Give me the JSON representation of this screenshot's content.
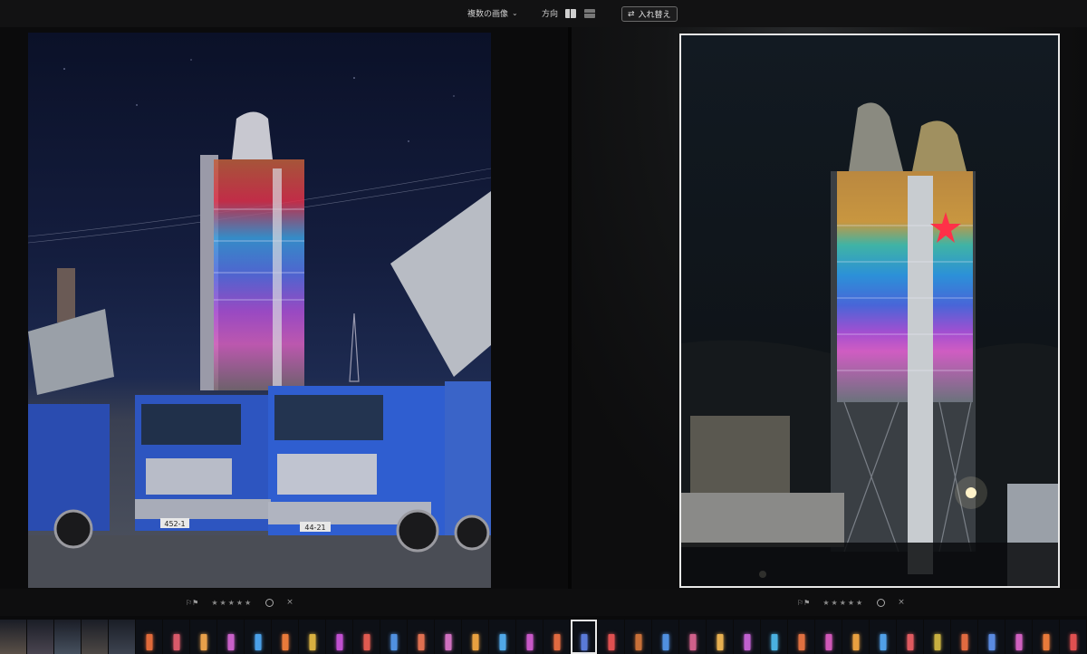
{
  "toolbar": {
    "view_mode_label": "複数の画像",
    "direction_label": "方向",
    "swap_label": "入れ替え"
  },
  "left_image": {
    "truck_plates": [
      "452-1",
      "44-21"
    ]
  },
  "rating_bar": {
    "stars": "★★★★★",
    "reject": "×"
  },
  "filmstrip": {
    "selected_index": 21,
    "thumbs": [
      {
        "kind": "industrial",
        "color": "#5a5048"
      },
      {
        "kind": "industrial",
        "color": "#4a4550"
      },
      {
        "kind": "industrial",
        "color": "#46505e"
      },
      {
        "kind": "industrial",
        "color": "#4d4845"
      },
      {
        "kind": "industrial",
        "color": "#3d4350"
      },
      {
        "kind": "tower",
        "color": "#e06a3a"
      },
      {
        "kind": "tower",
        "color": "#d95a6a"
      },
      {
        "kind": "tower",
        "color": "#e8a04a"
      },
      {
        "kind": "tower",
        "color": "#c860c8"
      },
      {
        "kind": "tower",
        "color": "#4aa0e8"
      },
      {
        "kind": "tower",
        "color": "#e87a3a"
      },
      {
        "kind": "tower",
        "color": "#d8b040"
      },
      {
        "kind": "tower",
        "color": "#c050d0"
      },
      {
        "kind": "tower",
        "color": "#e05a50"
      },
      {
        "kind": "tower",
        "color": "#5090e0"
      },
      {
        "kind": "tower",
        "color": "#e07050"
      },
      {
        "kind": "tower",
        "color": "#d070c0"
      },
      {
        "kind": "tower",
        "color": "#e8a040"
      },
      {
        "kind": "tower",
        "color": "#50a8e8"
      },
      {
        "kind": "tower",
        "color": "#c858c8"
      },
      {
        "kind": "tower",
        "color": "#e06a40"
      },
      {
        "kind": "tower",
        "color": "#5a7ad8"
      },
      {
        "kind": "tower",
        "color": "#e05050"
      },
      {
        "kind": "tower",
        "color": "#c87038"
      },
      {
        "kind": "tower",
        "color": "#5090e0"
      },
      {
        "kind": "tower",
        "color": "#d0608a"
      },
      {
        "kind": "tower",
        "color": "#e8b050"
      },
      {
        "kind": "tower",
        "color": "#c060d0"
      },
      {
        "kind": "tower",
        "color": "#4ab0e0"
      },
      {
        "kind": "tower",
        "color": "#e07040"
      },
      {
        "kind": "tower",
        "color": "#d058b8"
      },
      {
        "kind": "tower",
        "color": "#e8a040"
      },
      {
        "kind": "tower",
        "color": "#50a0e8"
      },
      {
        "kind": "tower",
        "color": "#e05a60"
      },
      {
        "kind": "tower",
        "color": "#c8b040"
      },
      {
        "kind": "tower",
        "color": "#e06a40"
      },
      {
        "kind": "tower",
        "color": "#5a8ae0"
      },
      {
        "kind": "tower",
        "color": "#d060c0"
      },
      {
        "kind": "tower",
        "color": "#e87a3a"
      },
      {
        "kind": "tower",
        "color": "#e05050"
      }
    ]
  }
}
